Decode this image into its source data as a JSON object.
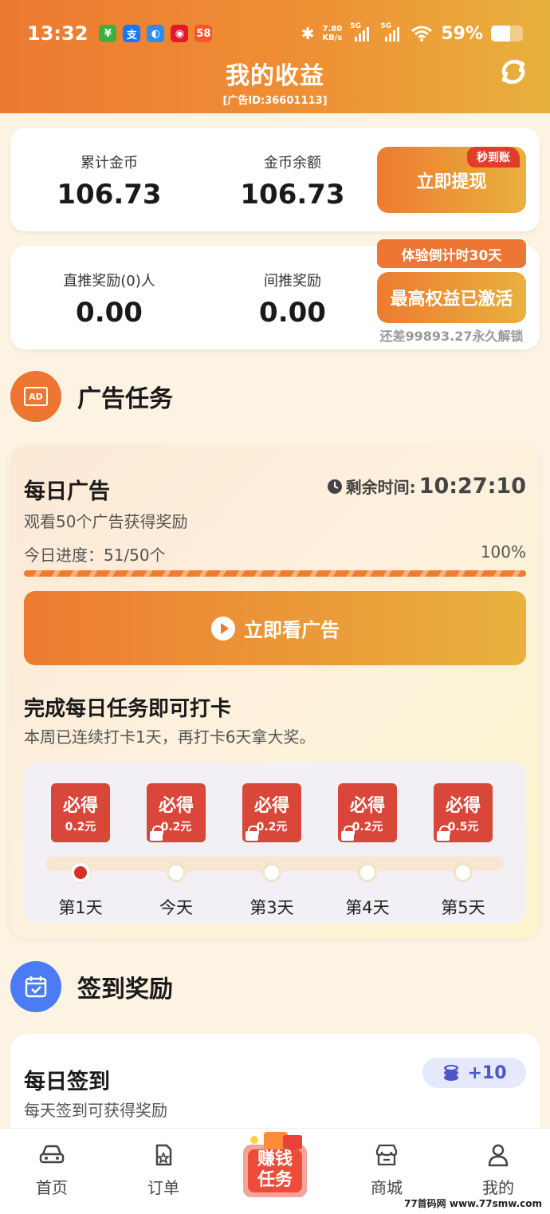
{
  "status_bar": {
    "time": "13:32",
    "net_speed_value": "7.80",
    "net_speed_unit": "KB/s",
    "signal1": "5G",
    "signal2": "5G",
    "battery": "59%",
    "battery_level": 0.59,
    "apps": [
      {
        "glyph": "¥",
        "color": "#3fae3a"
      },
      {
        "glyph": "支",
        "color": "#1677ff"
      },
      {
        "glyph": "◐",
        "color": "#2d8cf0"
      },
      {
        "glyph": "◉",
        "color": "#e6162d"
      },
      {
        "glyph": "58",
        "color": "#ff552e"
      }
    ]
  },
  "header": {
    "title": "我的收益",
    "ad_id": "[广告ID:36601113]"
  },
  "summary": {
    "total_coins_label": "累计金币",
    "total_coins_value": "106.73",
    "balance_label": "金币余额",
    "balance_value": "106.73",
    "withdraw_button": "立即提现",
    "withdraw_badge": "秒到账"
  },
  "rewards": {
    "direct_label": "直推奖励(0)人",
    "direct_value": "0.00",
    "indirect_label": "间推奖励",
    "indirect_value": "0.00",
    "countdown_tag": "体验倒计时30天",
    "activated_button": "最高权益已激活",
    "unlock_hint": "还差99893.27永久解锁"
  },
  "ad_section": {
    "title": "广告任务",
    "icon_text": "AD",
    "card_title": "每日广告",
    "time_label": "剩余时间:",
    "time_value": "10:27:10",
    "subtitle": "观看50个广告获得奖励",
    "progress_label": "今日进度：51/50个",
    "progress_percent": "100%",
    "progress_fraction": 1.0,
    "watch_button": "立即看广告",
    "checkin_title": "完成每日任务即可打卡",
    "checkin_subtitle": "本周已连续打卡1天，再打卡6天拿大奖。",
    "days": [
      {
        "reward_title": "必得",
        "reward_amount": "0.2元",
        "label": "第1天",
        "done": true,
        "locked": false
      },
      {
        "reward_title": "必得",
        "reward_amount": "0.2元",
        "label": "今天",
        "done": false,
        "locked": true
      },
      {
        "reward_title": "必得",
        "reward_amount": "0.2元",
        "label": "第3天",
        "done": false,
        "locked": true
      },
      {
        "reward_title": "必得",
        "reward_amount": "0.2元",
        "label": "第4天",
        "done": false,
        "locked": true
      },
      {
        "reward_title": "必得",
        "reward_amount": "0.5元",
        "label": "第5天",
        "done": false,
        "locked": true
      }
    ]
  },
  "signin_section": {
    "title": "签到奖励",
    "card_title": "每日签到",
    "card_subtitle": "每天签到可获得奖励",
    "coin_reward": "+10"
  },
  "tabbar": {
    "home": "首页",
    "orders": "订单",
    "earn_line1": "赚钱",
    "earn_line2": "任务",
    "mall": "商城",
    "mine": "我的"
  },
  "watermark": "77首码网 www.77smw.com",
  "colors": {
    "accent": "#ee7d33",
    "accent_end": "#e8b13d",
    "badge_red": "#e33d2a",
    "reward_red": "#d9473a",
    "sign_blue": "#4b7bf5"
  }
}
